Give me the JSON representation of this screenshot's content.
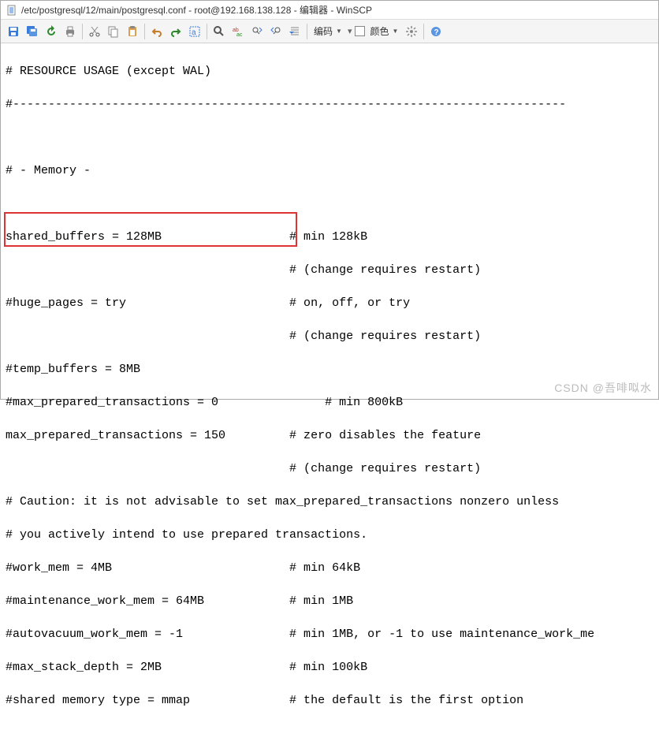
{
  "window": {
    "title": "/etc/postgresql/12/main/postgresql.conf - root@192.168.138.128 - 编辑器 - WinSCP"
  },
  "toolbar": {
    "encoding_label": "编码",
    "color_label": "颜色"
  },
  "editor": {
    "lines": [
      "# RESOURCE USAGE (except WAL)",
      "#------------------------------------------------------------------------------",
      "",
      "# - Memory -",
      "",
      "shared_buffers = 128MB                  # min 128kB",
      "                                        # (change requires restart)",
      "#huge_pages = try                       # on, off, or try",
      "                                        # (change requires restart)",
      "#temp_buffers = 8MB",
      "#max_prepared_transactions = 0               # min 800kB",
      "max_prepared_transactions = 150         # zero disables the feature",
      "                                        # (change requires restart)",
      "# Caution: it is not advisable to set max_prepared_transactions nonzero unless",
      "# you actively intend to use prepared transactions.",
      "#work_mem = 4MB                         # min 64kB",
      "#maintenance_work_mem = 64MB            # min 1MB",
      "#autovacuum_work_mem = -1               # min 1MB, or -1 to use maintenance_work_me",
      "#max_stack_depth = 2MB                  # min 100kB",
      "#shared memory type = mmap              # the default is the first option"
    ]
  },
  "watermark": "CSDN @吾啡㕽水"
}
